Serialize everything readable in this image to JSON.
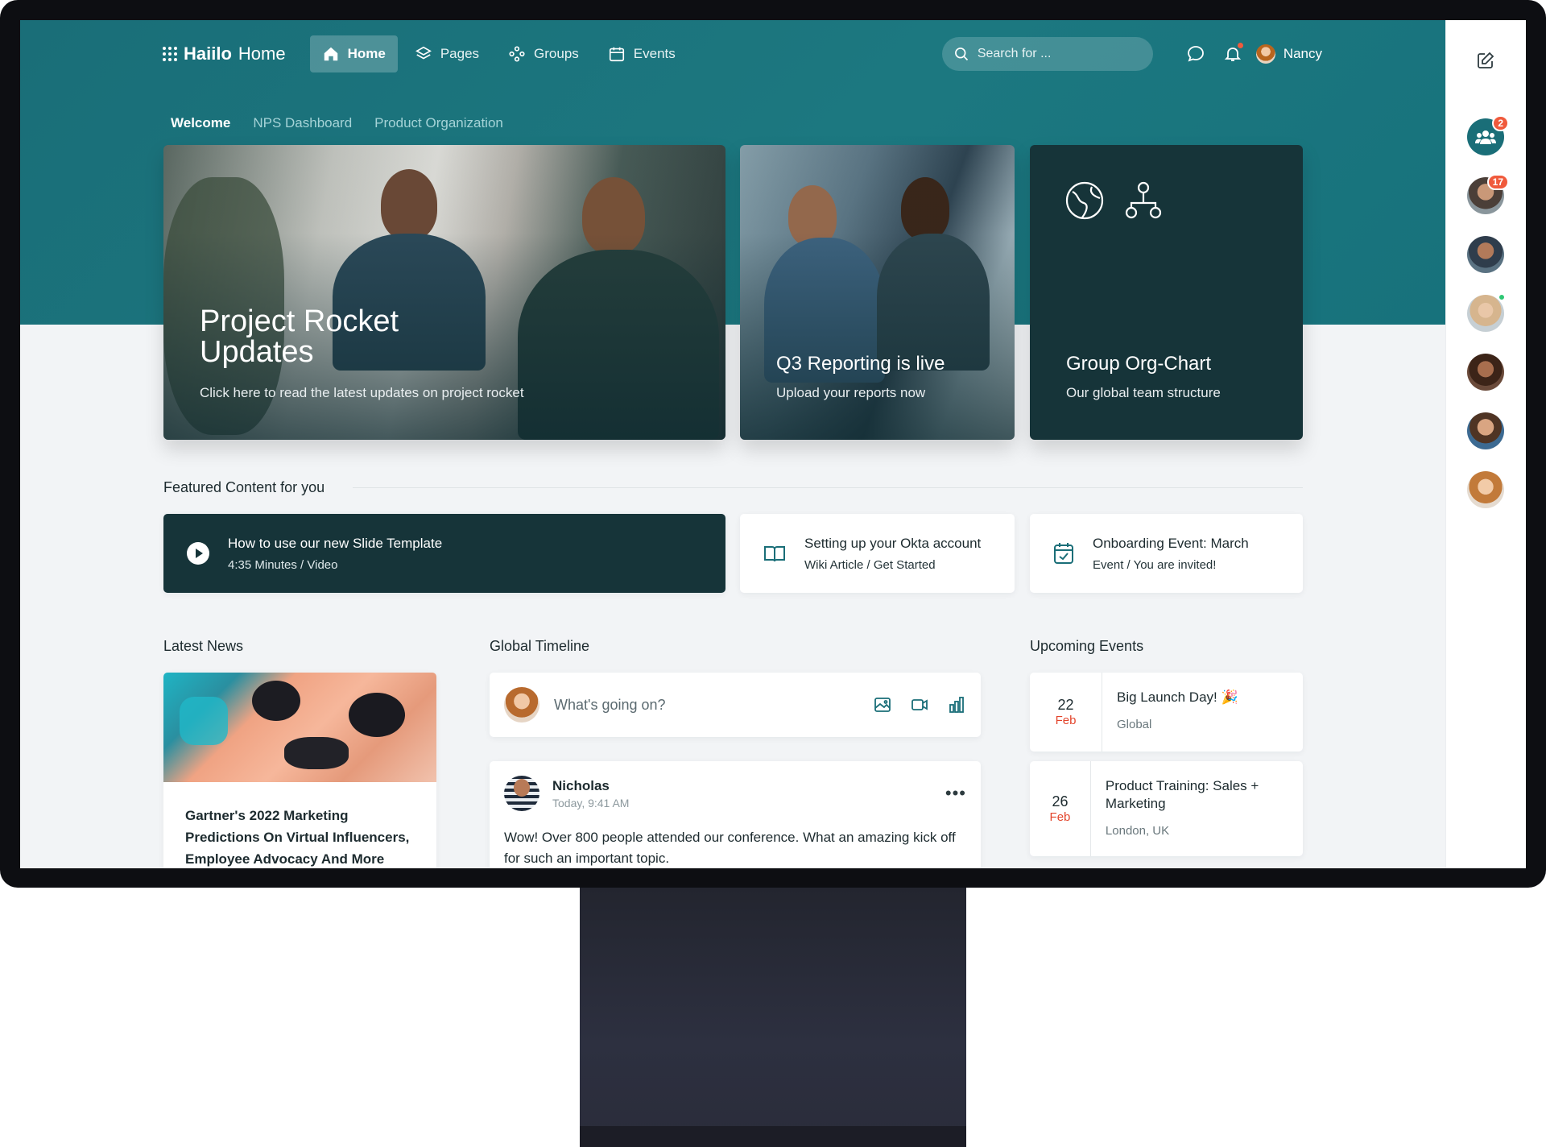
{
  "nav": {
    "logo_bold": "Haiilo",
    "logo_light": "Home",
    "items": [
      {
        "label": "Home",
        "icon": "home-icon",
        "active": true
      },
      {
        "label": "Pages",
        "icon": "layers-icon"
      },
      {
        "label": "Groups",
        "icon": "groups-icon"
      },
      {
        "label": "Events",
        "icon": "calendar-icon"
      }
    ],
    "search_placeholder": "Search for ...",
    "user_name": "Nancy"
  },
  "subtabs": [
    "Welcome",
    "NPS Dashboard",
    "Product Organization"
  ],
  "hero": [
    {
      "title_line1": "Project Rocket",
      "title_line2": "Updates",
      "subtitle": "Click here to read the latest updates on project rocket"
    },
    {
      "title": "Q3 Reporting is live",
      "subtitle": "Upload your reports now"
    },
    {
      "title": "Group Org-Chart",
      "subtitle": "Our global team structure"
    }
  ],
  "featured": {
    "heading": "Featured Content for you",
    "items": [
      {
        "title": "How to use our new Slide Template",
        "meta": "4:35 Minutes / Video",
        "icon": "play-icon"
      },
      {
        "title": "Setting up your Okta account",
        "meta": "Wiki Article / Get Started",
        "icon": "book-icon"
      },
      {
        "title": "Onboarding Event: March",
        "meta": "Event / You are invited!",
        "icon": "calendar-check-icon"
      }
    ]
  },
  "news": {
    "heading": "Latest News",
    "title": "Gartner's 2022 Marketing Predictions On Virtual Influencers, Employee Advocacy And More"
  },
  "timeline": {
    "heading": "Global Timeline",
    "composer_placeholder": "What's going on?",
    "post": {
      "author": "Nicholas",
      "time": "Today, 9:41 AM",
      "body": "Wow! Over 800 people attended our conference. What an amazing kick off for such an important topic.",
      "more": "•••"
    }
  },
  "events": {
    "heading": "Upcoming Events",
    "items": [
      {
        "day": "22",
        "month": "Feb",
        "title": "Big Launch Day! 🎉",
        "location": "Global"
      },
      {
        "day": "26",
        "month": "Feb",
        "title": "Product Training: Sales + Marketing",
        "location": "London, UK"
      }
    ]
  },
  "rail": {
    "badges": [
      "2",
      "17"
    ]
  },
  "colors": {
    "teal": "#1a6e78",
    "dark_card": "#163439",
    "accent_red": "#e3452c",
    "badge": "#f05a3c"
  }
}
